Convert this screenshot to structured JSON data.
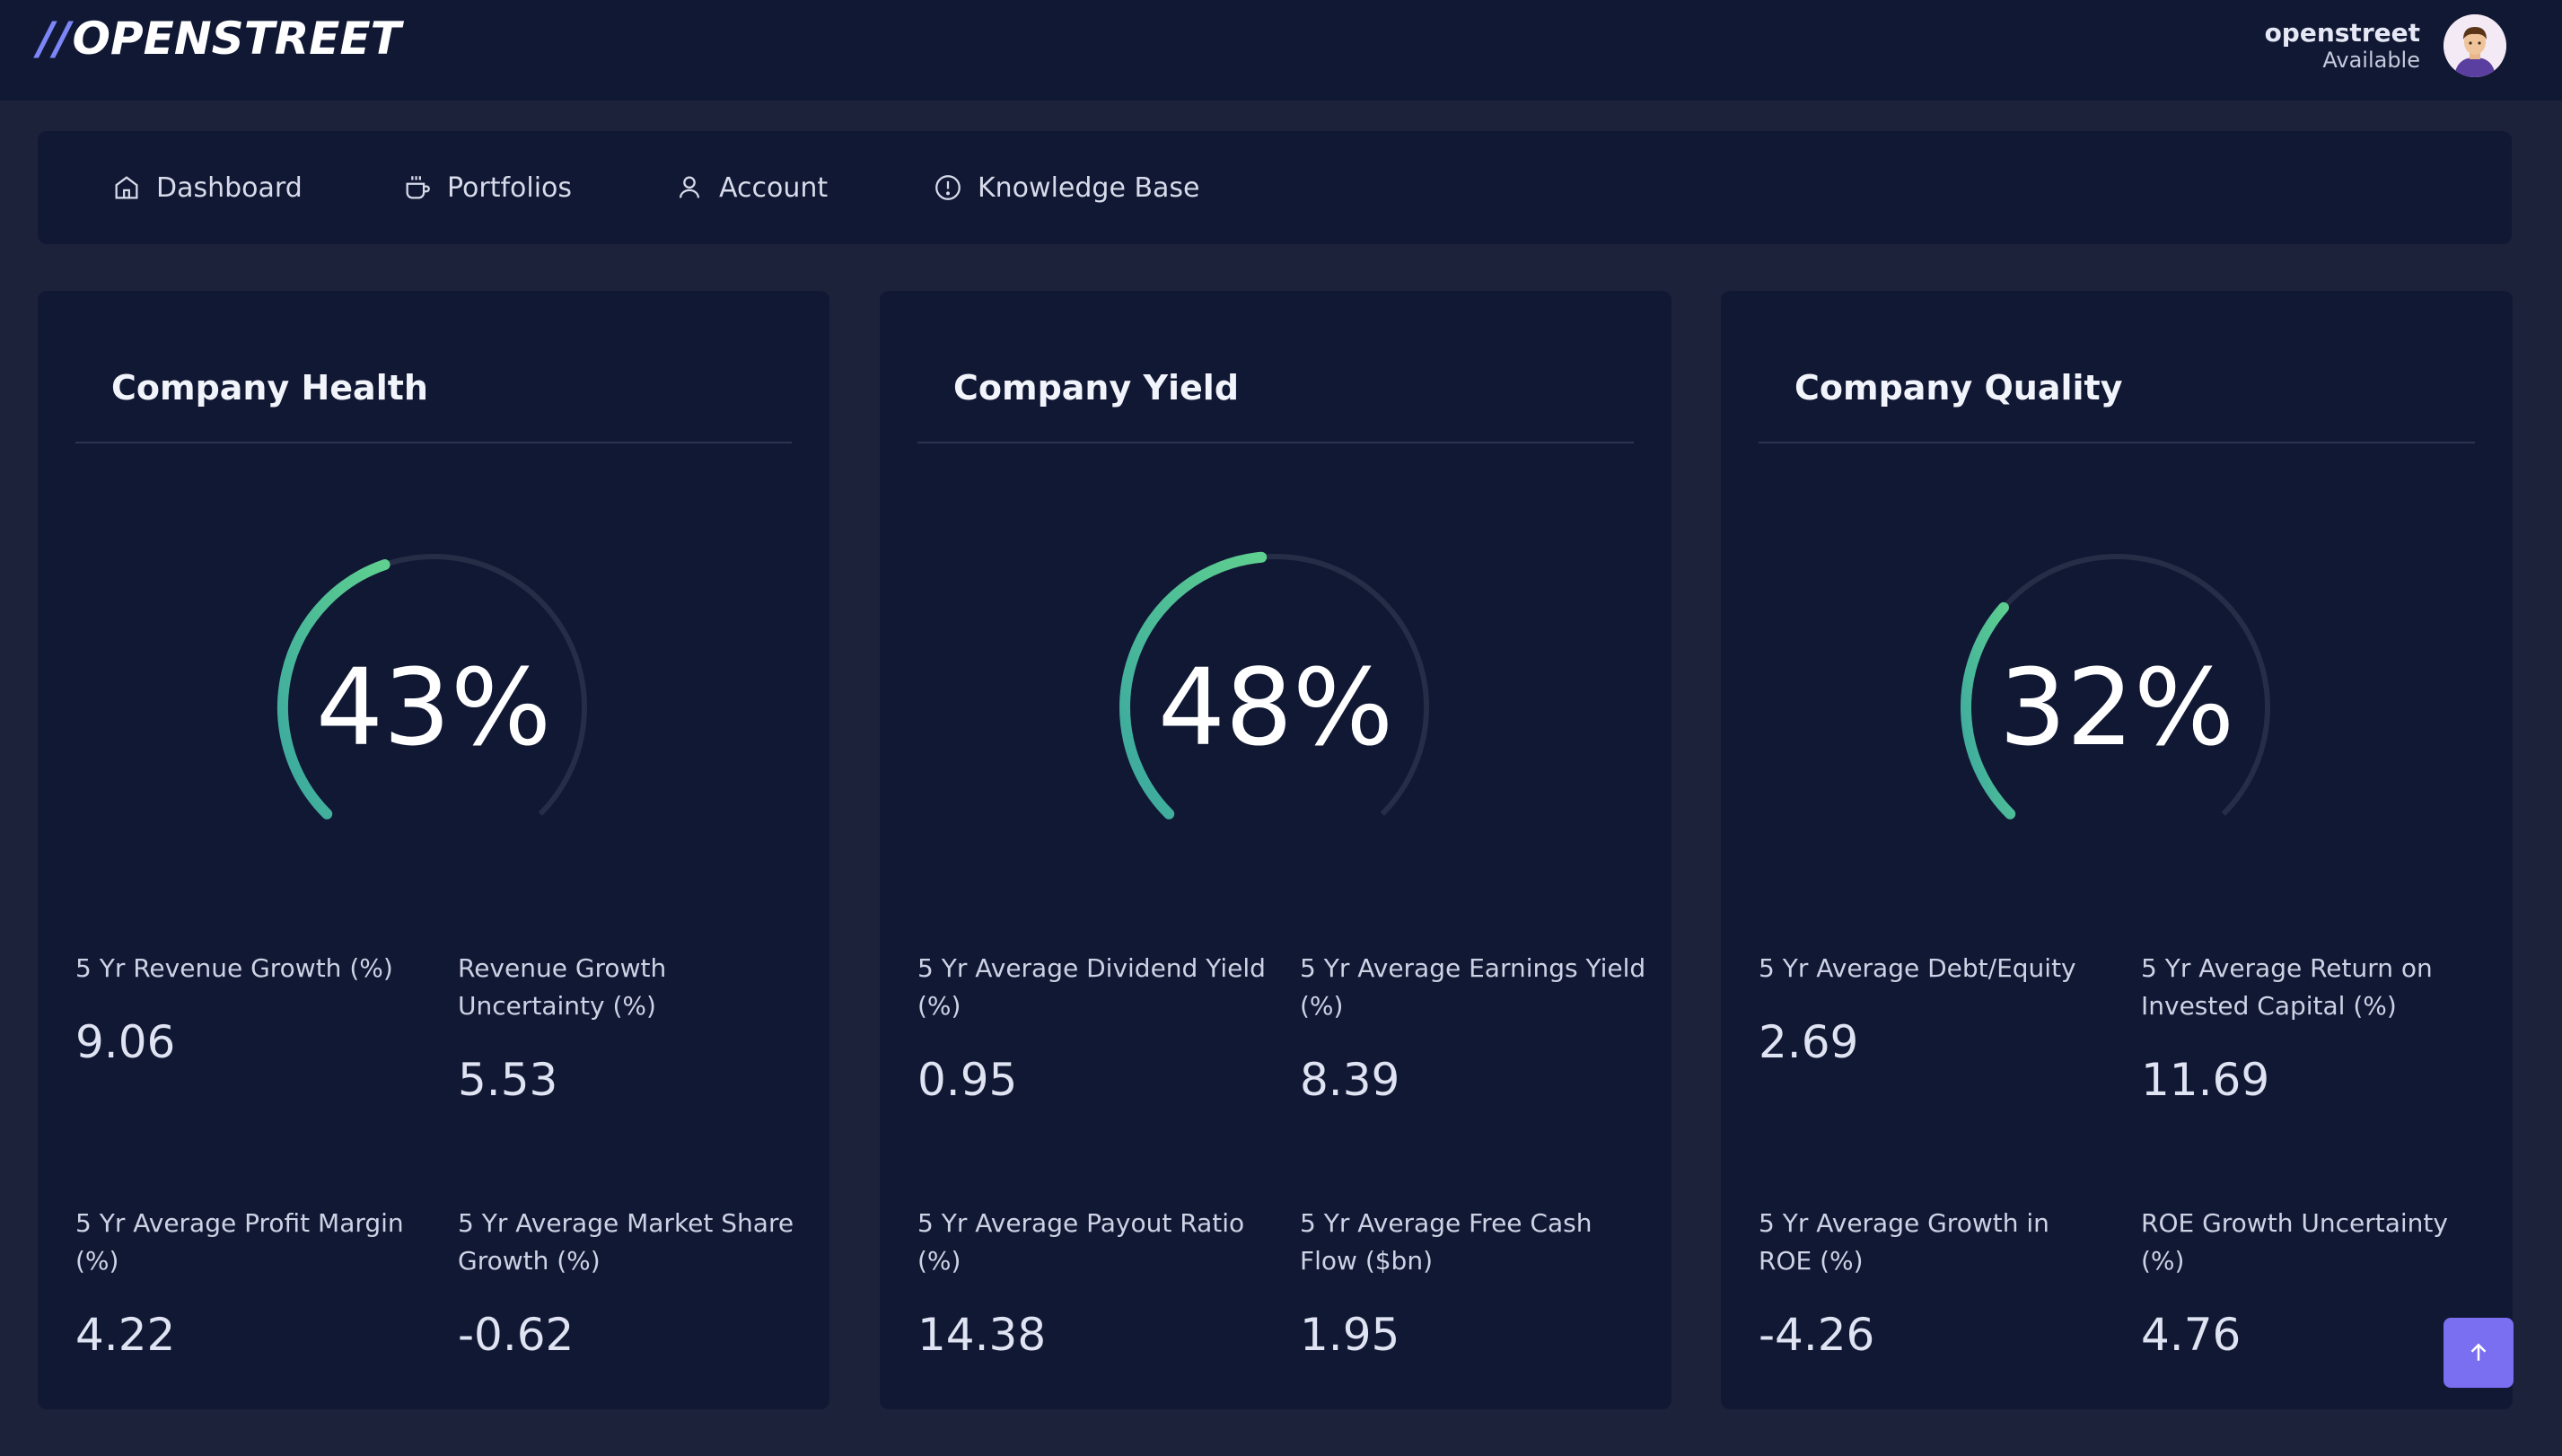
{
  "app": {
    "logo_slashes": "//",
    "logo_text": "OPENSTREET",
    "accent_color": "#7c86f7",
    "gauge_color": "#4cc49a"
  },
  "user": {
    "name": "openstreet",
    "status": "Available"
  },
  "nav": {
    "items": [
      {
        "label": "Dashboard",
        "icon": "home-icon"
      },
      {
        "label": "Portfolios",
        "icon": "cup-icon"
      },
      {
        "label": "Account",
        "icon": "user-icon"
      },
      {
        "label": "Knowledge Base",
        "icon": "info-icon"
      }
    ]
  },
  "cards": [
    {
      "title": "Company Health",
      "gauge_percent": 43,
      "gauge_label": "43%",
      "metrics": [
        {
          "label": "5 Yr Revenue Growth (%)",
          "value": "9.06"
        },
        {
          "label": "Revenue Growth Uncertainty (%)",
          "value": "5.53"
        },
        {
          "label": "5 Yr Average Profit Margin (%)",
          "value": "4.22"
        },
        {
          "label": "5 Yr Average Market Share Growth (%)",
          "value": "-0.62"
        }
      ]
    },
    {
      "title": "Company Yield",
      "gauge_percent": 48,
      "gauge_label": "48%",
      "metrics": [
        {
          "label": "5 Yr Average Dividend Yield (%)",
          "value": "0.95"
        },
        {
          "label": "5 Yr Average Earnings Yield (%)",
          "value": "8.39"
        },
        {
          "label": "5 Yr Average Payout Ratio (%)",
          "value": "14.38"
        },
        {
          "label": "5 Yr Average Free Cash Flow ($bn)",
          "value": "1.95"
        }
      ]
    },
    {
      "title": "Company Quality",
      "gauge_percent": 32,
      "gauge_label": "32%",
      "metrics": [
        {
          "label": "5 Yr Average Debt/Equity",
          "value": "2.69"
        },
        {
          "label": "5 Yr Average Return on Invested Capital (%)",
          "value": "11.69"
        },
        {
          "label": "5 Yr Average Growth in ROE (%)",
          "value": "-4.26"
        },
        {
          "label": "ROE Growth Uncertainty (%)",
          "value": "4.76"
        }
      ]
    }
  ]
}
